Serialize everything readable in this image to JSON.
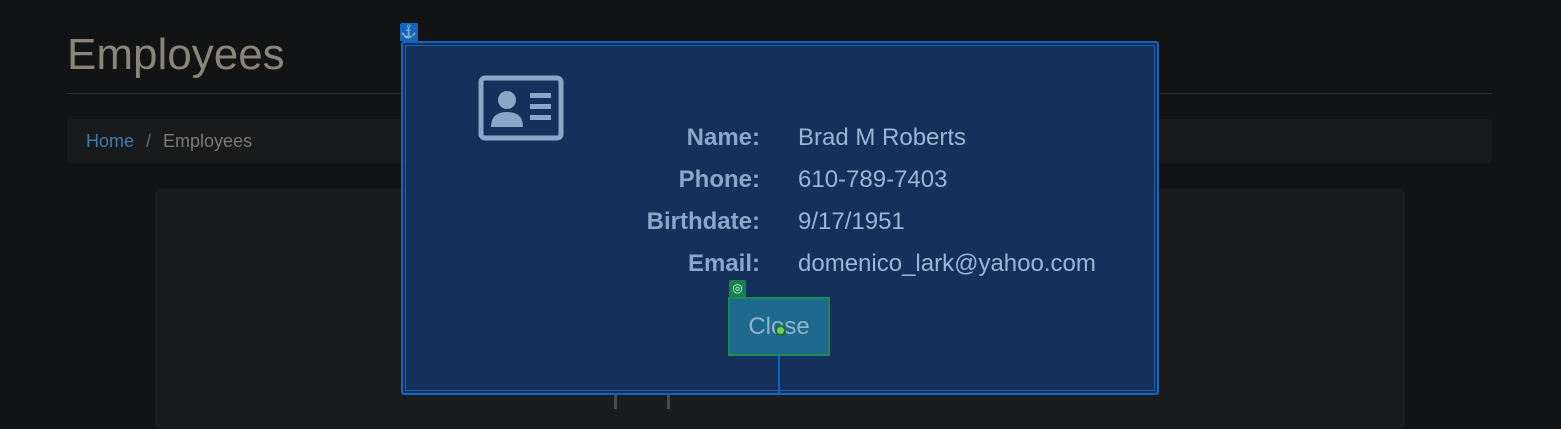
{
  "page": {
    "title": "Employees"
  },
  "breadcrumb": {
    "home": "Home",
    "separator": "/",
    "current": "Employees"
  },
  "modal": {
    "anchor_icon": "anchor-icon",
    "card_icon": "id-card-icon",
    "fields": [
      {
        "label": "Name:",
        "value": "Brad M Roberts"
      },
      {
        "label": "Phone:",
        "value": "610-789-7403"
      },
      {
        "label": "Birthdate:",
        "value": "9/17/1951"
      },
      {
        "label": "Email:",
        "value": "domenico_lark@yahoo.com"
      }
    ],
    "close_label": "Close",
    "close_target_icon": "target-icon"
  },
  "colors": {
    "background": "#111314",
    "modal_bg": "#13315a",
    "modal_border": "#1565c0",
    "link": "#3f7cb0",
    "close_button": "#1e6a8f"
  }
}
